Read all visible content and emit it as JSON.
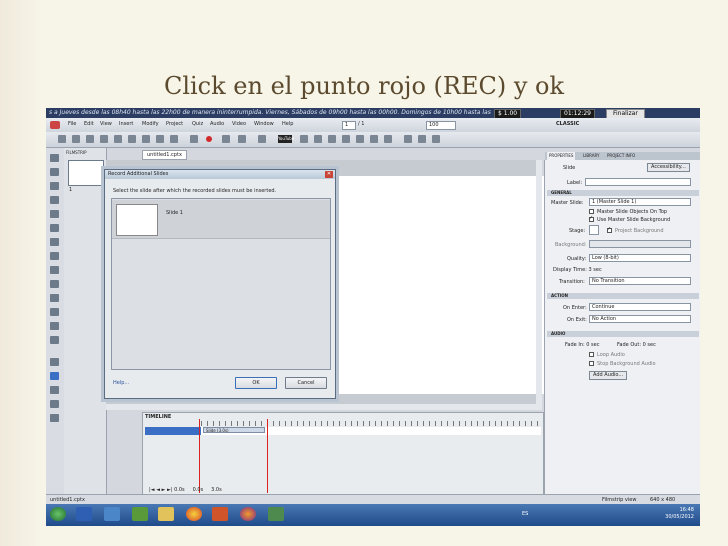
{
  "slide": {
    "title": "Click en el punto rojo (REC) y ok"
  },
  "recorder": {
    "info_text": "s a Jueves desde las 08h40 hasta las 22h00 de manera ininterrumpida. Viernes, Sábados de 09h00 hasta las 00h00. Domingos de 10h00 hasta las",
    "amount": "$ 1.00",
    "timer": "01:12:29",
    "finalize_label": "Finalizar"
  },
  "menu": {
    "items": [
      "File",
      "Edit",
      "View",
      "Insert",
      "Modify",
      "Project",
      "Quiz",
      "Audio",
      "Video",
      "Window",
      "Help"
    ],
    "page_current": "1",
    "page_total": "/ 1",
    "zoom": "100",
    "workspace": "CLASSIC"
  },
  "toolbar": {
    "youtube_label": "YouTube"
  },
  "filmstrip": {
    "tab": "FILMSTRIP",
    "slide_number": "1"
  },
  "document": {
    "tab_label": "untitled1.cptx"
  },
  "dialog": {
    "title": "Record Additional Slides",
    "instruction": "Select the slide after which the recorded slides must be inserted.",
    "item_label": "Slide 1",
    "help_label": "Help...",
    "ok_label": "OK",
    "cancel_label": "Cancel"
  },
  "timeline": {
    "tab": "TIMELINE",
    "row_label": "Slide (3.0s)",
    "track_label": "Slide (3.0s)",
    "time_start": "0.0s",
    "time_mid": "0.0s",
    "time_end": "3.0s"
  },
  "properties": {
    "tabs": [
      "PROPERTIES",
      "LIBRARY",
      "PROJECT INFO"
    ],
    "header": "Slide",
    "accessibility_label": "Accessibility...",
    "label_caption": "Label:",
    "general_section": "GENERAL",
    "master_slide_caption": "Master Slide:",
    "master_slide_value": "1 (Master Slide 1)",
    "master_on_top": "Master Slide Objects On Top",
    "use_master_bg": "Use Master Slide Background",
    "stage_caption": "Stage:",
    "project_bg": "Project Background",
    "background_caption": "Background:",
    "quality_caption": "Quality:",
    "quality_value": "Low (8-bit)",
    "display_time": "Display Time: 3 sec",
    "transition_caption": "Transition:",
    "transition_value": "No Transition",
    "action_section": "ACTION",
    "on_enter_caption": "On Enter:",
    "on_enter_value": "Continue",
    "on_exit_caption": "On Exit:",
    "on_exit_value": "No Action",
    "audio_section": "AUDIO",
    "fade_in": "Fade In: 0 sec",
    "fade_out": "Fade Out: 0 sec",
    "loop_audio": "Loop Audio",
    "stop_bg_audio": "Stop Background Audio",
    "add_audio_label": "Add Audio..."
  },
  "statusbar": {
    "file": "untitled1.cptx",
    "view": "Filmstrip view",
    "size": "640 x 480"
  },
  "taskbar": {
    "lang": "ES",
    "time": "16:48",
    "date": "30/05/2012"
  },
  "colors": {
    "slide_title": "#5b4a2e",
    "taskbar": "#2c5a98",
    "rec_dot": "#d12a2a",
    "selection": "#3b6fc6"
  }
}
